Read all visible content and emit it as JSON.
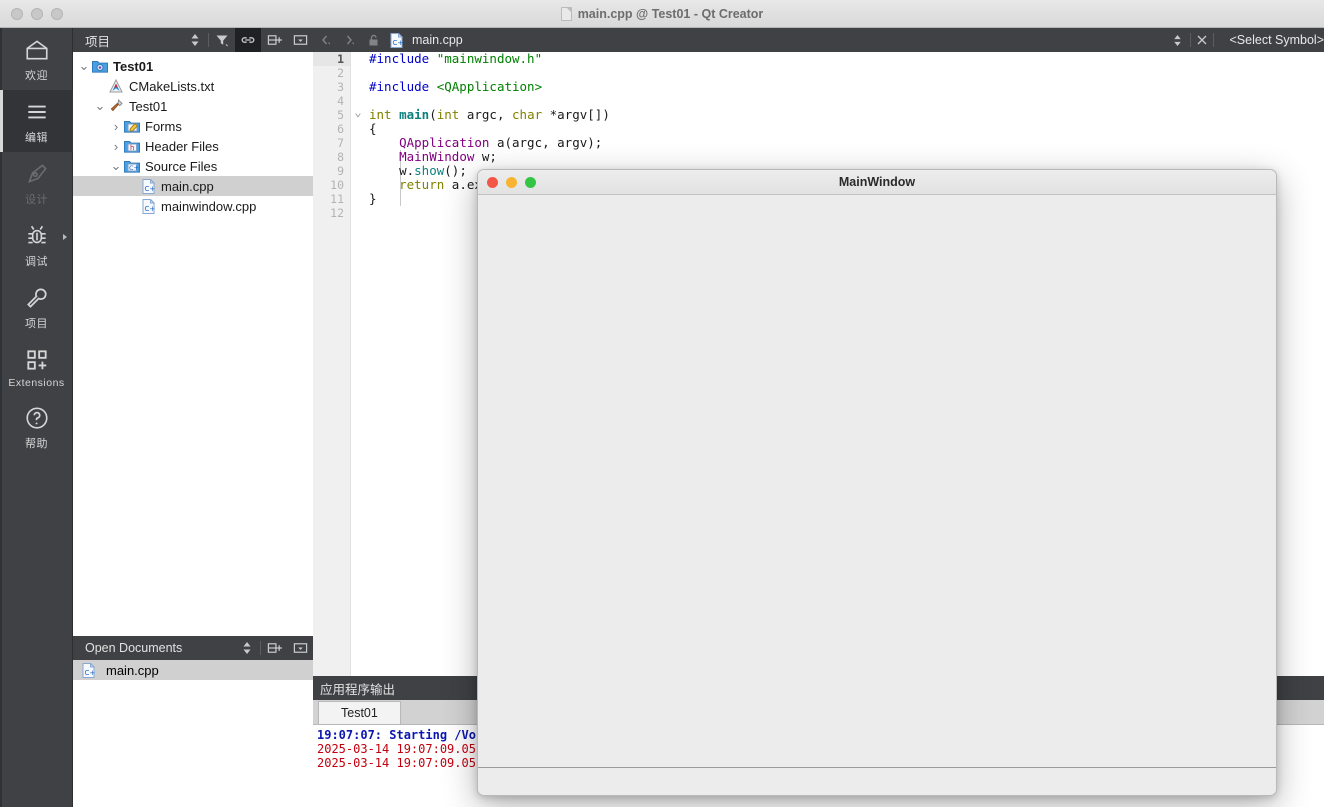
{
  "window": {
    "title": "main.cpp @ Test01 - Qt Creator",
    "traffic_lights": [
      "close",
      "minimize",
      "zoom"
    ]
  },
  "modebar": {
    "items": [
      {
        "label": "欢迎",
        "icon": "home-icon",
        "state": "enabled"
      },
      {
        "label": "编辑",
        "icon": "edit-lines-icon",
        "state": "active"
      },
      {
        "label": "设计",
        "icon": "design-pen-icon",
        "state": "disabled"
      },
      {
        "label": "调试",
        "icon": "debug-bug-icon",
        "state": "enabled",
        "has_submenu": true
      },
      {
        "label": "项目",
        "icon": "projects-wrench-icon",
        "state": "enabled"
      },
      {
        "label": "Extensions",
        "icon": "extensions-grid-icon",
        "state": "enabled"
      },
      {
        "label": "帮助",
        "icon": "help-question-icon",
        "state": "enabled"
      }
    ]
  },
  "projects_panel": {
    "title": "项目",
    "toolbar": [
      {
        "name": "sync-selector",
        "icon": "up-down-arrows-icon",
        "active": false
      },
      {
        "name": "filter",
        "icon": "filter-icon",
        "active": false
      },
      {
        "name": "link-with-editor",
        "icon": "link-icon",
        "active": true
      },
      {
        "name": "split",
        "icon": "split-add-icon",
        "active": false
      },
      {
        "name": "close-panel",
        "icon": "minimize-box-icon",
        "active": false
      }
    ],
    "tree": [
      {
        "label": "Test01",
        "icon": "project-folder-icon",
        "depth": 0,
        "twisty": "open",
        "bold": true,
        "selected": false
      },
      {
        "label": "CMakeLists.txt",
        "icon": "cmake-icon",
        "depth": 1,
        "twisty": "none",
        "bold": false,
        "selected": false
      },
      {
        "label": "Test01",
        "icon": "hammer-icon",
        "depth": 1,
        "twisty": "open",
        "bold": false,
        "selected": false
      },
      {
        "label": "Forms",
        "icon": "forms-folder-icon",
        "depth": 2,
        "twisty": "closed",
        "bold": false,
        "selected": false
      },
      {
        "label": "Header Files",
        "icon": "header-folder-icon",
        "depth": 2,
        "twisty": "closed",
        "bold": false,
        "selected": false
      },
      {
        "label": "Source Files",
        "icon": "source-folder-icon",
        "depth": 2,
        "twisty": "open",
        "bold": false,
        "selected": false
      },
      {
        "label": "main.cpp",
        "icon": "cpp-file-icon",
        "depth": 3,
        "twisty": "none",
        "bold": false,
        "selected": true
      },
      {
        "label": "mainwindow.cpp",
        "icon": "cpp-file-icon",
        "depth": 3,
        "twisty": "none",
        "bold": false,
        "selected": false
      }
    ]
  },
  "open_documents_panel": {
    "title": "Open Documents",
    "toolbar": [
      {
        "name": "sync-selector",
        "icon": "up-down-arrows-icon"
      },
      {
        "name": "split",
        "icon": "split-add-icon"
      },
      {
        "name": "close-panel",
        "icon": "minimize-box-icon"
      }
    ],
    "items": [
      {
        "label": "main.cpp",
        "icon": "cpp-file-icon",
        "selected": true
      }
    ]
  },
  "editor": {
    "toolbar": {
      "back": "‹",
      "forward": "›",
      "lock_icon": "unlocked-icon",
      "file_icon": "cpp-file-icon",
      "filename": "main.cpp",
      "updown_icon": "up-down-arrows-icon",
      "close_icon": "close-x-icon",
      "symbol_selector": "<Select Symbol>"
    },
    "current_line": 1,
    "line_numbers": [
      "1",
      "2",
      "3",
      "4",
      "5",
      "6",
      "7",
      "8",
      "9",
      "10",
      "11",
      "12"
    ],
    "fold_markers": {
      "5": "open"
    },
    "lines": [
      [
        {
          "t": "#include ",
          "c": "pre"
        },
        {
          "t": "\"mainwindow.h\"",
          "c": "str"
        }
      ],
      [],
      [
        {
          "t": "#include ",
          "c": "pre"
        },
        {
          "t": "<QApplication>",
          "c": "str"
        }
      ],
      [],
      [
        {
          "t": "int ",
          "c": "kw"
        },
        {
          "t": "main",
          "c": "fn"
        },
        {
          "t": "(",
          "c": "plain"
        },
        {
          "t": "int",
          "c": "kw"
        },
        {
          "t": " argc, ",
          "c": "plain"
        },
        {
          "t": "char",
          "c": "kw"
        },
        {
          "t": " *argv[])",
          "c": "plain"
        }
      ],
      [
        {
          "t": "{",
          "c": "plain"
        }
      ],
      [
        {
          "t": "    ",
          "c": "plain"
        },
        {
          "t": "QApplication",
          "c": "type"
        },
        {
          "t": " a(argc, argv);",
          "c": "plain"
        }
      ],
      [
        {
          "t": "    ",
          "c": "plain"
        },
        {
          "t": "MainWindow",
          "c": "type"
        },
        {
          "t": " w;",
          "c": "plain"
        }
      ],
      [
        {
          "t": "    w.",
          "c": "plain"
        },
        {
          "t": "show",
          "c": "meth"
        },
        {
          "t": "();",
          "c": "plain"
        }
      ],
      [
        {
          "t": "    ",
          "c": "plain"
        },
        {
          "t": "return",
          "c": "kw"
        },
        {
          "t": " a.ex",
          "c": "plain"
        }
      ],
      [
        {
          "t": "}",
          "c": "plain"
        }
      ],
      []
    ]
  },
  "output_pane": {
    "title": "应用程序输出",
    "tabs": [
      {
        "label": "Test01",
        "active": true
      }
    ],
    "lines": [
      {
        "text": "19:07:07: Starting /Vo",
        "color": "blue"
      },
      {
        "text": "2025-03-14 19:07:09.05",
        "color": "red"
      },
      {
        "text": "2025-03-14 19:07:09.05",
        "color": "red"
      }
    ]
  },
  "app_dialog": {
    "title": "MainWindow",
    "traffic_lights": [
      {
        "name": "close",
        "color": "#f35547"
      },
      {
        "name": "minimize",
        "color": "#f7b432"
      },
      {
        "name": "zoom",
        "color": "#34c544"
      }
    ]
  },
  "colors": {
    "chrome_dark": "#3f4145",
    "mode_active": "#323438",
    "selection": "#d0d0d0",
    "preproc": "#0000c8",
    "string": "#008000",
    "keyword": "#808000",
    "function": "#0e7f7f",
    "type": "#800080",
    "output_blue": "#0b16b0",
    "output_red": "#c4000d"
  }
}
